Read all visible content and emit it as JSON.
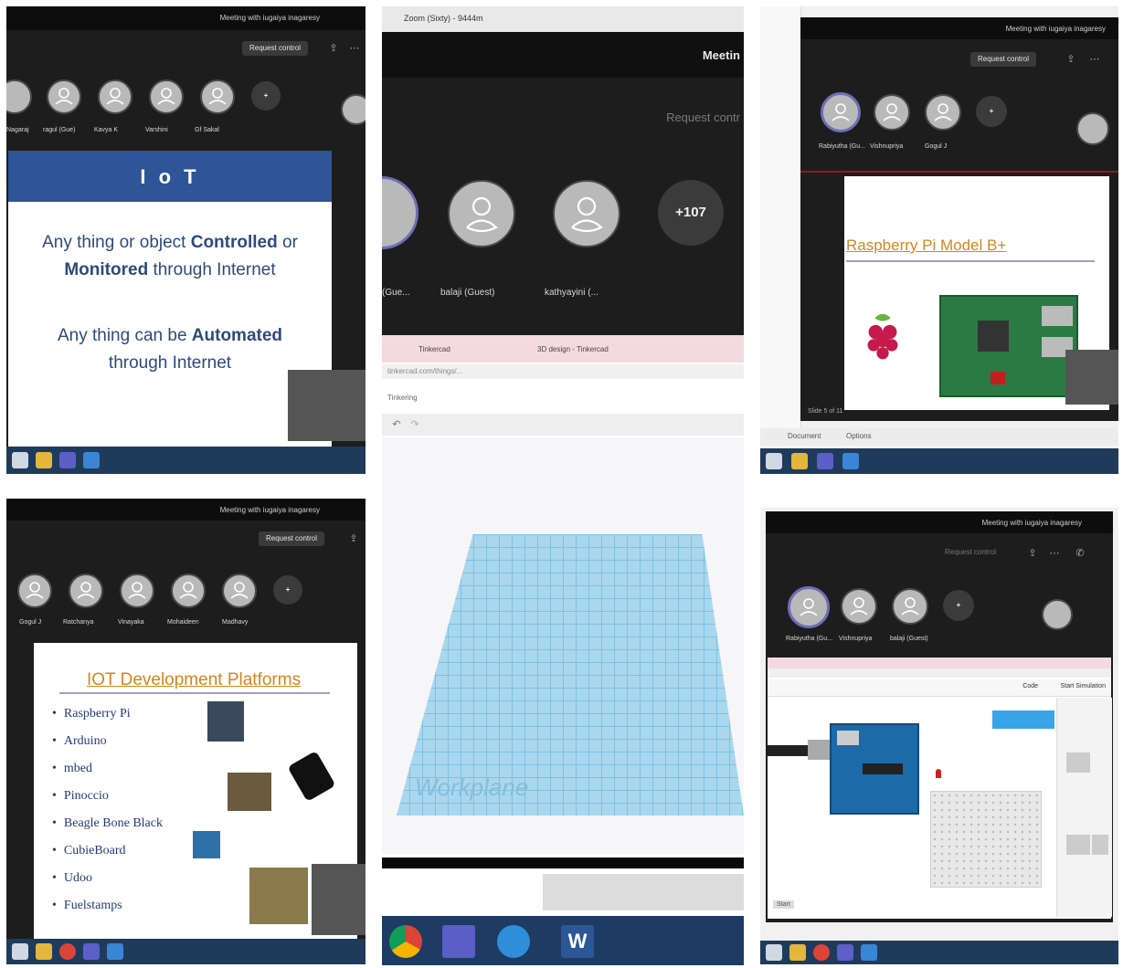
{
  "colors": {
    "meeting_bg": "#1d1d1d",
    "slide_header_blue": "#2d5597",
    "taskbar": "#1f3b5c",
    "accent_purple": "#6e6eb6",
    "workplane_blue": "#a9d7ee"
  },
  "panel1": {
    "meeting_title": "Meeting with iugaiya inagaresy",
    "request_control": "Request control",
    "participants": [
      "Nagaraj",
      "ragul (Gue)",
      "Kavya K",
      "Varshini",
      "Gf Sakal"
    ],
    "slide_header": "I o T",
    "line1_pre": "Any thing or object ",
    "line1_bold": "Controlled",
    "line1_post": " or",
    "line2_bold": "Monitored",
    "line2_post": " through Internet",
    "line3_pre": "Any thing can be ",
    "line3_bold": "Automated",
    "line4": "through Internet"
  },
  "panel2": {
    "browser_tab": "Zoom (Sixty) - 9444m",
    "meeting_title": "Meetin",
    "request_control": "Request contr",
    "participants": [
      "(Gue...",
      "balaji (Guest)",
      "kathyayini (..."
    ],
    "more_count": "+107",
    "tab1": "Tinkercad",
    "tab2": "3D design - Tinkercad",
    "url": "tinkercad.com/things/...",
    "toolbar_label": "Tinkering",
    "workplane_label": "Workplane"
  },
  "panel3": {
    "meeting_title": "Meeting with iugaiya inagaresy",
    "request_control": "Request control",
    "participants": [
      "Rabiyutha (Gu...",
      "Vishnupriya",
      "Gogul J"
    ],
    "slide_title": "Raspberry Pi Model B+",
    "caption": "Slide 5 of 11",
    "status_left": "Document",
    "status_mid": "Options"
  },
  "panel4": {
    "meeting_title": "Meeting with iugaiya inagaresy",
    "request_control": "Request control",
    "participants": [
      "Gogul J",
      "Ratchanya",
      "Vinayaka",
      "Mohaideen",
      "Madhavy"
    ],
    "slide_title": "IOT Development Platforms",
    "items": [
      "Raspberry Pi",
      "Arduino",
      "mbed",
      "Pinoccio",
      "Beagle Bone Black",
      "CubieBoard",
      "Udoo",
      "Fuelstamps"
    ]
  },
  "panel5": {
    "meeting_title": "Meeting with iugaiya inagaresy",
    "request_control": "Request control",
    "participants": [
      "Rabiyutha (Gu...",
      "Vishnupriya",
      "balaji (Guest)"
    ],
    "code_label": "Code",
    "sim_label": "Start Simulation",
    "start_label": "Start"
  }
}
